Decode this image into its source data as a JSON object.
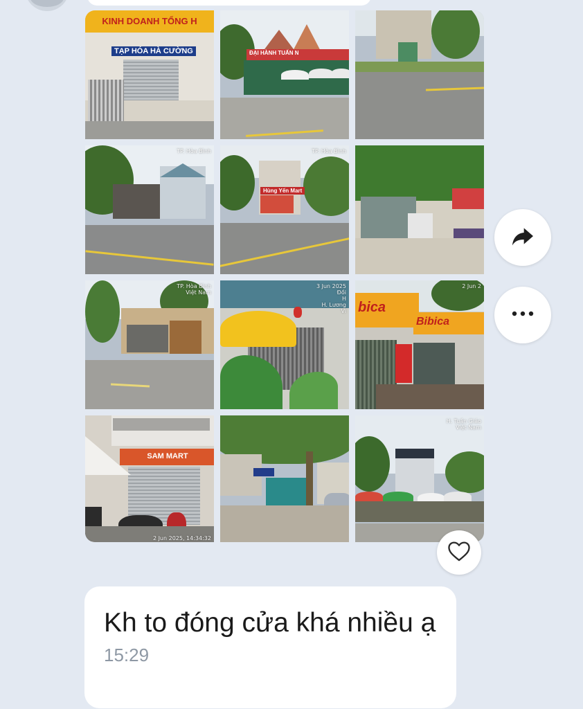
{
  "chat": {
    "photo_album": {
      "photos": [
        {
          "sign": "TẠP HÓA HÀ CƯỜNG",
          "sign2": "KINH DOANH TỔNG H",
          "stamp": ""
        },
        {
          "sign": "ĐẠI HÀNH TUẤN N",
          "sign2": "",
          "stamp": ""
        },
        {
          "sign": "",
          "sign2": "",
          "stamp": ""
        },
        {
          "sign": "",
          "sign2": "",
          "stamp": "TP. Hòa Bình"
        },
        {
          "sign": "Hùng Yến Mart",
          "sign2": "",
          "stamp": "TP. Hòa Bình"
        },
        {
          "sign": "",
          "sign2": "",
          "stamp": ""
        },
        {
          "sign": "",
          "sign2": "",
          "stamp": "TP. Hòa Bình\nViệt Nam"
        },
        {
          "sign": "",
          "sign2": "",
          "stamp": "3 Jun 2025\nĐồi\nH\nH. Lương\nVi"
        },
        {
          "sign": "bica",
          "sign2": "Bibica",
          "stamp": "2 Jun 2"
        },
        {
          "sign": "SAM MART",
          "sign2": "",
          "stamp": "",
          "stamp_bottom": "2 Jun 2025, 14:34:32"
        },
        {
          "sign": "",
          "sign2": "",
          "stamp": ""
        },
        {
          "sign": "",
          "sign2": "",
          "stamp": "H. Tuần Giáo\nViệt Nam"
        }
      ]
    },
    "actions": {
      "share_icon": "share-arrow-icon",
      "more_icon": "more-horizontal-icon",
      "like_icon": "heart-outline-icon"
    },
    "message": {
      "text": "Kh to đóng cửa khá nhiều ạ",
      "time": "15:29"
    }
  },
  "colors": {
    "background": "#e3e9f2",
    "bubble": "#ffffff",
    "time_text": "#8e98a4",
    "icon": "#1f1f1f"
  }
}
